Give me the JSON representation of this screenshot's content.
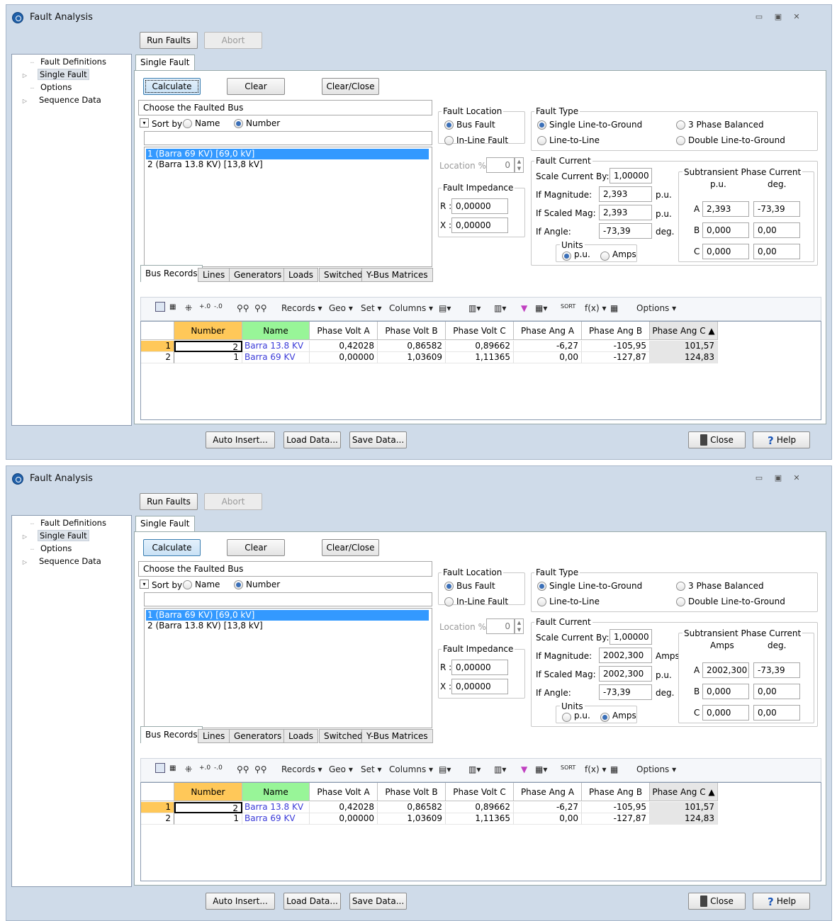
{
  "windows": [
    {
      "title": "Fault Analysis",
      "title_controls": [
        "▭",
        "▣",
        "✕"
      ],
      "run_faults": "Run Faults",
      "abort": "Abort",
      "tree": [
        {
          "label": "Fault Definitions",
          "toggle": "",
          "line": "┈"
        },
        {
          "label": "Single Fault",
          "toggle": "▷",
          "line": ""
        },
        {
          "label": "Options",
          "toggle": "",
          "line": "┈"
        },
        {
          "label": "Sequence Data",
          "toggle": "▷",
          "line": ""
        }
      ],
      "tab": "Single Fault",
      "calculate": "Calculate",
      "clear": "Clear",
      "clear_close": "Clear/Close",
      "choose_bus": "Choose the Faulted Bus",
      "sort_by": "Sort by",
      "sort_name": "Name",
      "sort_number": "Number",
      "bus_list": [
        "1 (Barra 69 KV)  [69,0 kV]",
        "2 (Barra 13.8 KV)  [13,8 kV]"
      ],
      "fault_location": "Fault Location",
      "bus_fault": "Bus Fault",
      "inline_fault": "In-Line Fault",
      "location_label": "Location %",
      "location_value": "0",
      "fault_impedance": "Fault Impedance",
      "r_label": "R :",
      "r_value": "0,00000",
      "x_label": "X :",
      "x_value": "0,00000",
      "fault_type": "Fault Type",
      "slg": "Single Line-to-Ground",
      "ll": "Line-to-Line",
      "three_phase": "3 Phase Balanced",
      "dlg": "Double Line-to-Ground",
      "fault_current": "Fault Current",
      "scale_by": "Scale Current By:",
      "scale_value": "1,00000",
      "if_mag": "If Magnitude:",
      "if_mag_value": "2,393",
      "if_mag_unit": "p.u.",
      "if_scaled": "If Scaled Mag:",
      "if_scaled_value": "2,393",
      "if_scaled_unit": "p.u.",
      "if_angle": "If Angle:",
      "if_angle_value": "-73,39",
      "if_angle_unit": "deg.",
      "units": "Units",
      "units_pu": "p.u.",
      "units_amps": "Amps",
      "units_selected": "pu",
      "subtrans": "Subtransient Phase Current",
      "sub_col1": "p.u.",
      "sub_col2": "deg.",
      "phases": [
        {
          "ph": "A",
          "mag": "2,393",
          "ang": "-73,39"
        },
        {
          "ph": "B",
          "mag": "0,000",
          "ang": "0,00"
        },
        {
          "ph": "C",
          "mag": "0,000",
          "ang": "0,00"
        }
      ],
      "rec_tabs": [
        "Bus Records",
        "Lines",
        "Generators",
        "Loads",
        "Switched Shunt Buses",
        "Y-Bus Matrices"
      ],
      "toolbar": {
        "records": "Records ▾",
        "geo": "Geo ▾",
        "set": "Set ▾",
        "columns": "Columns ▾",
        "fx": "f(x) ▾",
        "options": "Options ▾"
      },
      "grid": {
        "headers": [
          "Number",
          "Name",
          "Phase Volt A",
          "Phase Volt B",
          "Phase Volt C",
          "Phase Ang A",
          "Phase Ang B",
          "Phase Ang C ▲"
        ],
        "rows": [
          {
            "idx": "1",
            "num": "2",
            "name": "Barra 13.8 KV",
            "va": "0,42028",
            "vb": "0,86582",
            "vc": "0,89662",
            "aa": "-6,27",
            "ab": "-105,95",
            "ac": "101,57"
          },
          {
            "idx": "2",
            "num": "1",
            "name": "Barra 69 KV",
            "va": "0,00000",
            "vb": "1,03609",
            "vc": "1,11365",
            "aa": "0,00",
            "ab": "-127,87",
            "ac": "124,83"
          }
        ]
      },
      "auto_insert": "Auto Insert...",
      "load_data": "Load Data...",
      "save_data": "Save Data...",
      "close": "Close",
      "help": "Help"
    },
    {
      "title": "Fault Analysis",
      "title_controls": [
        "▭",
        "▣",
        "✕"
      ],
      "run_faults": "Run Faults",
      "abort": "Abort",
      "tree": [
        {
          "label": "Fault Definitions",
          "toggle": "",
          "line": "┈"
        },
        {
          "label": "Single Fault",
          "toggle": "▷",
          "line": ""
        },
        {
          "label": "Options",
          "toggle": "",
          "line": "┈"
        },
        {
          "label": "Sequence Data",
          "toggle": "▷",
          "line": ""
        }
      ],
      "tab": "Single Fault",
      "calculate": "Calculate",
      "clear": "Clear",
      "clear_close": "Clear/Close",
      "choose_bus": "Choose the Faulted Bus",
      "sort_by": "Sort by",
      "sort_name": "Name",
      "sort_number": "Number",
      "bus_list": [
        "1 (Barra 69 KV)  [69,0 kV]",
        "2 (Barra 13.8 KV)  [13,8 kV]"
      ],
      "fault_location": "Fault Location",
      "bus_fault": "Bus Fault",
      "inline_fault": "In-Line Fault",
      "location_label": "Location %",
      "location_value": "0",
      "fault_impedance": "Fault Impedance",
      "r_label": "R :",
      "r_value": "0,00000",
      "x_label": "X :",
      "x_value": "0,00000",
      "fault_type": "Fault Type",
      "slg": "Single Line-to-Ground",
      "ll": "Line-to-Line",
      "three_phase": "3 Phase Balanced",
      "dlg": "Double Line-to-Ground",
      "fault_current": "Fault Current",
      "scale_by": "Scale Current By:",
      "scale_value": "1,00000",
      "if_mag": "If Magnitude:",
      "if_mag_value": "2002,300",
      "if_mag_unit": "Amps",
      "if_scaled": "If Scaled Mag:",
      "if_scaled_value": "2002,300",
      "if_scaled_unit": "p.u.",
      "if_angle": "If Angle:",
      "if_angle_value": "-73,39",
      "if_angle_unit": "deg.",
      "units": "Units",
      "units_pu": "p.u.",
      "units_amps": "Amps",
      "units_selected": "amps",
      "subtrans": "Subtransient Phase Current",
      "sub_col1": "Amps",
      "sub_col2": "deg.",
      "phases": [
        {
          "ph": "A",
          "mag": "2002,300",
          "ang": "-73,39"
        },
        {
          "ph": "B",
          "mag": "0,000",
          "ang": "0,00"
        },
        {
          "ph": "C",
          "mag": "0,000",
          "ang": "0,00"
        }
      ],
      "rec_tabs": [
        "Bus Records",
        "Lines",
        "Generators",
        "Loads",
        "Switched Shunt Buses",
        "Y-Bus Matrices"
      ],
      "toolbar": {
        "records": "Records ▾",
        "geo": "Geo ▾",
        "set": "Set ▾",
        "columns": "Columns ▾",
        "fx": "f(x) ▾",
        "options": "Options ▾"
      },
      "grid": {
        "headers": [
          "Number",
          "Name",
          "Phase Volt A",
          "Phase Volt B",
          "Phase Volt C",
          "Phase Ang A",
          "Phase Ang B",
          "Phase Ang C ▲"
        ],
        "rows": [
          {
            "idx": "1",
            "num": "2",
            "name": "Barra 13.8 KV",
            "va": "0,42028",
            "vb": "0,86582",
            "vc": "0,89662",
            "aa": "-6,27",
            "ab": "-105,95",
            "ac": "101,57"
          },
          {
            "idx": "2",
            "num": "1",
            "name": "Barra 69 KV",
            "va": "0,00000",
            "vb": "1,03609",
            "vc": "1,11365",
            "aa": "0,00",
            "ab": "-127,87",
            "ac": "124,83"
          }
        ]
      },
      "auto_insert": "Auto Insert...",
      "load_data": "Load Data...",
      "save_data": "Save Data...",
      "close": "Close",
      "help": "Help"
    }
  ]
}
